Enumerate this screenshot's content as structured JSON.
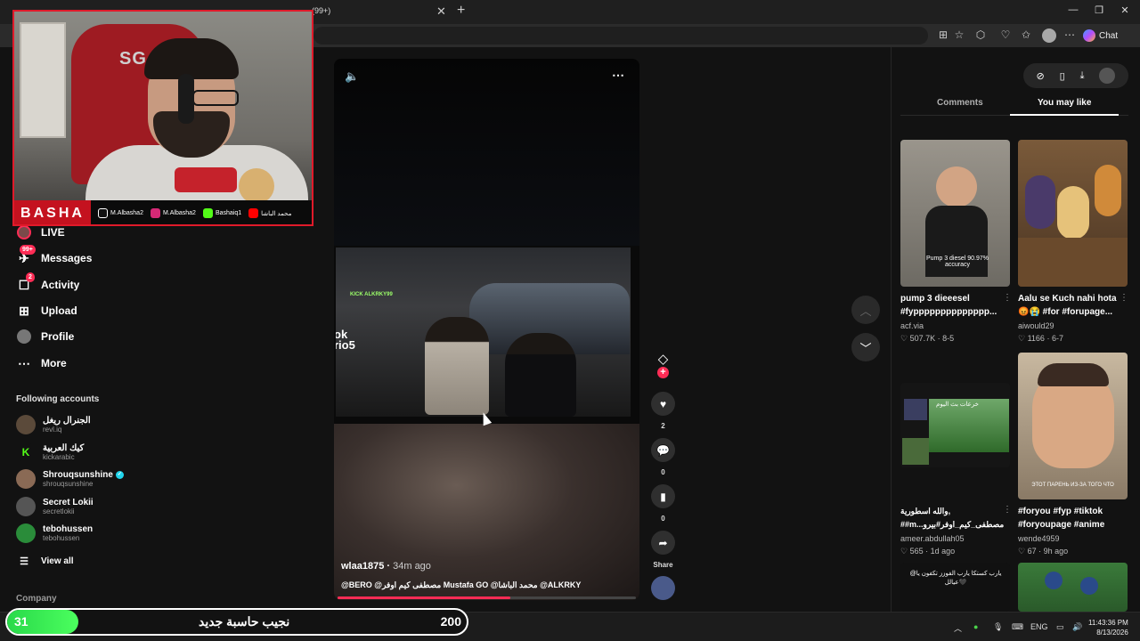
{
  "browser": {
    "tab_badge": "(99+)",
    "chat_label": "Chat"
  },
  "webcam": {
    "name": "BASHA",
    "chair_logo": "SG",
    "socials": [
      {
        "icon": "tiktok-icon",
        "handle": "M.Albasha2",
        "color": "#111111"
      },
      {
        "icon": "instagram-icon",
        "handle": "M.Albasha2",
        "color": "#d62976"
      },
      {
        "icon": "kick-icon",
        "handle": "Bashaiq1",
        "color": "#53fc18"
      },
      {
        "icon": "youtube-icon",
        "handle": "محمد الباشا",
        "color": "#ff0000"
      }
    ]
  },
  "sidebar": {
    "items": [
      {
        "label": "LIVE",
        "icon": "live-icon"
      },
      {
        "label": "Messages",
        "icon": "messages-icon",
        "badge": "99+"
      },
      {
        "label": "Activity",
        "icon": "activity-icon",
        "badge": "2"
      },
      {
        "label": "Upload",
        "icon": "upload-icon"
      },
      {
        "label": "Profile",
        "icon": "profile-icon"
      },
      {
        "label": "More",
        "icon": "more-icon"
      }
    ],
    "following_title": "Following accounts",
    "accounts": [
      {
        "name": "الجنرال ريغل",
        "handle": "revl.iq",
        "color": "#5b4a3a",
        "initial": ""
      },
      {
        "name": "كيك العربية",
        "handle": "kickarabic",
        "color": "#121212",
        "initial": "K"
      },
      {
        "name": "Shrouqsunshine",
        "handle": "shrouqsunshine",
        "color": "#8a6a55",
        "initial": "",
        "verified": true
      },
      {
        "name": "Secret Lokii",
        "handle": "secretlokii",
        "color": "#555555",
        "initial": ""
      },
      {
        "name": "tebohussen",
        "handle": "tebohussen",
        "color": "#2a8c3a",
        "initial": ""
      }
    ],
    "view_all": "View all",
    "company": "Company"
  },
  "video": {
    "author": "wlaa1875",
    "time": "34m ago",
    "caption": "@BERO @مصطفى كيم اوفر Mustafa GO @محمد الباشا @ALKRKY",
    "overlay_small": "KICK ALKRKY99",
    "overlay_big": "ok\nrio5",
    "progress": 0.58
  },
  "rail": {
    "likes": "2",
    "comments": "0",
    "saves": "0",
    "share_label": "Share"
  },
  "right_panel": {
    "tab_comments": "Comments",
    "tab_you_may_like": "You may like",
    "cards": [
      {
        "title_1": "pump 3 dieeesel",
        "title_2": "#fypppppppppppppp...",
        "user": "acf.via",
        "likes": "507.7K",
        "date": "8-5",
        "thumb_text": "Pump 3 diesel 90.97% accuracy"
      },
      {
        "title_1": "Aalu se Kuch nahi hota",
        "title_2": "😡😭 #for #forupage...",
        "user": "aiwould29",
        "likes": "1166",
        "date": "6-7",
        "thumb_text": ""
      },
      {
        "title_1": "والله اسطورية,",
        "title_2": "##m...مصطفى_كيم_اوفر#بيرو",
        "user": "ameer.abdullah05",
        "likes": "565",
        "date": "1d ago",
        "thumb_text": "خرعات بث اليوم"
      },
      {
        "title_1": "#foryou #fyp #tiktok",
        "title_2": "#foryoupage #anime",
        "user": "wende4959",
        "likes": "67",
        "date": "9h ago",
        "thumb_text": "ЭТОТ ПАРЕНЬ ИЗ-ЗА ТОГО ЧТО"
      },
      {
        "title_1": "",
        "title_2": "",
        "user": "",
        "likes": "",
        "date": "",
        "thumb_text": "@يارب كستكا يارب الفوزز تكفون يا عيالل🖤"
      }
    ]
  },
  "goal": {
    "current": "31",
    "label": "نجيب حاسبة جديد",
    "max": "200",
    "fraction": 0.155
  },
  "taskbar": {
    "lang": "ENG",
    "time": "11:43:36 PM",
    "date": "8/13/2026"
  }
}
